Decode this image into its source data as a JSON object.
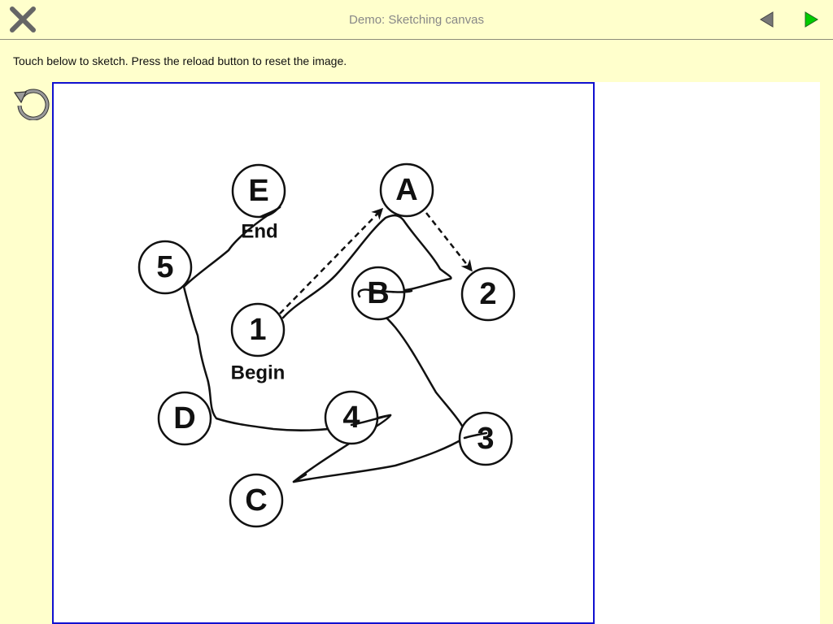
{
  "header": {
    "title": "Demo: Sketching canvas",
    "close_icon": "close-x-icon",
    "prev_icon": "triangle-left-icon",
    "next_icon": "triangle-right-icon",
    "next_color": "#00cc00",
    "prev_color": "#777777"
  },
  "instructions": "Touch below to sketch. Press the reload button to reset the image.",
  "reload_icon": "reload-icon",
  "canvas": {
    "border_color": "#1010d0",
    "nodes": {
      "E": "E",
      "A": "A",
      "five": "5",
      "B": "B",
      "two": "2",
      "one": "1",
      "D": "D",
      "four": "4",
      "three": "3",
      "C": "C"
    },
    "captions": {
      "end": "End",
      "begin": "Begin"
    }
  }
}
